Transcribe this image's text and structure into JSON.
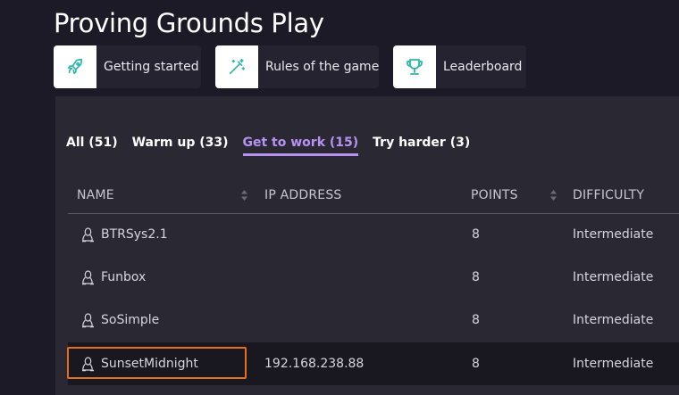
{
  "page": {
    "title": "Proving Grounds Play"
  },
  "quick_links": [
    {
      "label": "Getting started",
      "icon": "rocket-icon"
    },
    {
      "label": "Rules of the game",
      "icon": "magic-wand-icon"
    },
    {
      "label": "Leaderboard",
      "icon": "trophy-icon"
    }
  ],
  "colors": {
    "accent": "#b792f3",
    "icon_teal": "#2ab7a9",
    "highlight": "#e4701e"
  },
  "tabs": [
    {
      "label": "All (51)",
      "active": false
    },
    {
      "label": "Warm up (33)",
      "active": false
    },
    {
      "label": "Get to work (15)",
      "active": true
    },
    {
      "label": "Try harder (3)",
      "active": false
    }
  ],
  "table": {
    "columns": [
      "NAME",
      "IP ADDRESS",
      "POINTS",
      "DIFFICULTY"
    ],
    "rows": [
      {
        "name": "BTRSys2.1",
        "ip": "",
        "points": "8",
        "difficulty": "Intermediate"
      },
      {
        "name": "Funbox",
        "ip": "",
        "points": "8",
        "difficulty": "Intermediate"
      },
      {
        "name": "SoSimple",
        "ip": "",
        "points": "8",
        "difficulty": "Intermediate"
      },
      {
        "name": "SunsetMidnight",
        "ip": "192.168.238.88",
        "points": "8",
        "difficulty": "Intermediate"
      }
    ]
  }
}
